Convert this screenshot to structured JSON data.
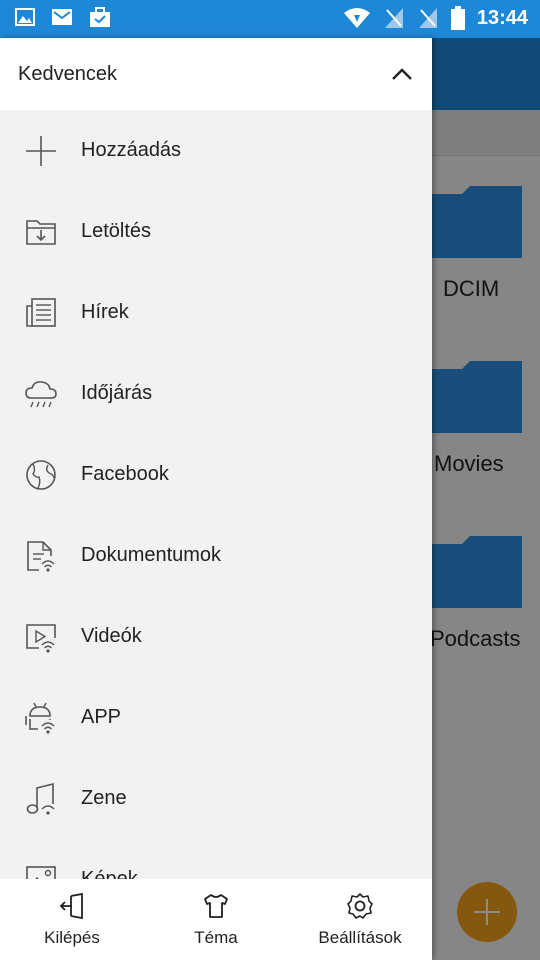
{
  "status_bar": {
    "time": "13:44",
    "left_icons": [
      "gallery-icon",
      "mail-icon",
      "briefcase-icon"
    ],
    "right_icons": [
      "wifi-icon",
      "no-signal-sim1-icon",
      "no-signal-sim2-icon",
      "battery-icon"
    ]
  },
  "background": {
    "folders": [
      "DCIM",
      "Movies",
      "Podcasts"
    ],
    "accent": "#1f88d6",
    "fab_color": "#f0a21c"
  },
  "drawer": {
    "title": "Kedvencek",
    "items": [
      {
        "label": "Hozzáadás",
        "icon": "plus-icon"
      },
      {
        "label": "Letöltés",
        "icon": "download-folder-icon"
      },
      {
        "label": "Hírek",
        "icon": "news-icon"
      },
      {
        "label": "Időjárás",
        "icon": "weather-cloud-icon"
      },
      {
        "label": "Facebook",
        "icon": "globe-icon"
      },
      {
        "label": "Dokumentumok",
        "icon": "network-document-icon"
      },
      {
        "label": "Videók",
        "icon": "network-video-icon"
      },
      {
        "label": "APP",
        "icon": "network-android-icon"
      },
      {
        "label": "Zene",
        "icon": "music-note-icon"
      },
      {
        "label": "Képek",
        "icon": "image-icon"
      }
    ],
    "bottom": {
      "exit": "Kilépés",
      "theme": "Téma",
      "settings": "Beállítások"
    }
  }
}
